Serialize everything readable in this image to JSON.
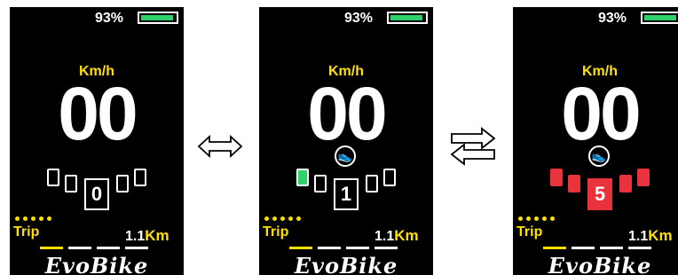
{
  "colors": {
    "screen_bg": "#000000",
    "text_primary": "#ffffff",
    "text_accent": "#ffe000",
    "battery_green": "#2fd36b",
    "assist_green": "#2fd36b",
    "assist_red": "#e8323c"
  },
  "displays": [
    {
      "battery_percent": "93%",
      "speed_unit": "Km/h",
      "speed": "00",
      "walk_assist_shown": false,
      "assist_level": "0",
      "assist_color": "none",
      "trip_label": "Trip",
      "distance_value": "1.1",
      "distance_unit": "Km",
      "brand": "EvoBike"
    },
    {
      "battery_percent": "93%",
      "speed_unit": "Km/h",
      "speed": "00",
      "walk_assist_shown": true,
      "walk_icon": "walk-assist-icon",
      "assist_level": "1",
      "assist_color": "green",
      "trip_label": "Trip",
      "distance_value": "1.1",
      "distance_unit": "Km",
      "brand": "EvoBike"
    },
    {
      "battery_percent": "93%",
      "speed_unit": "Km/h",
      "speed": "00",
      "walk_assist_shown": true,
      "walk_icon": "walk-assist-icon",
      "assist_level": "5",
      "assist_color": "red",
      "trip_label": "Trip",
      "distance_value": "1.1",
      "distance_unit": "Km",
      "brand": "EvoBike"
    }
  ],
  "arrows": [
    "double-headed-arrow-icon",
    "swap-arrows-icon"
  ]
}
